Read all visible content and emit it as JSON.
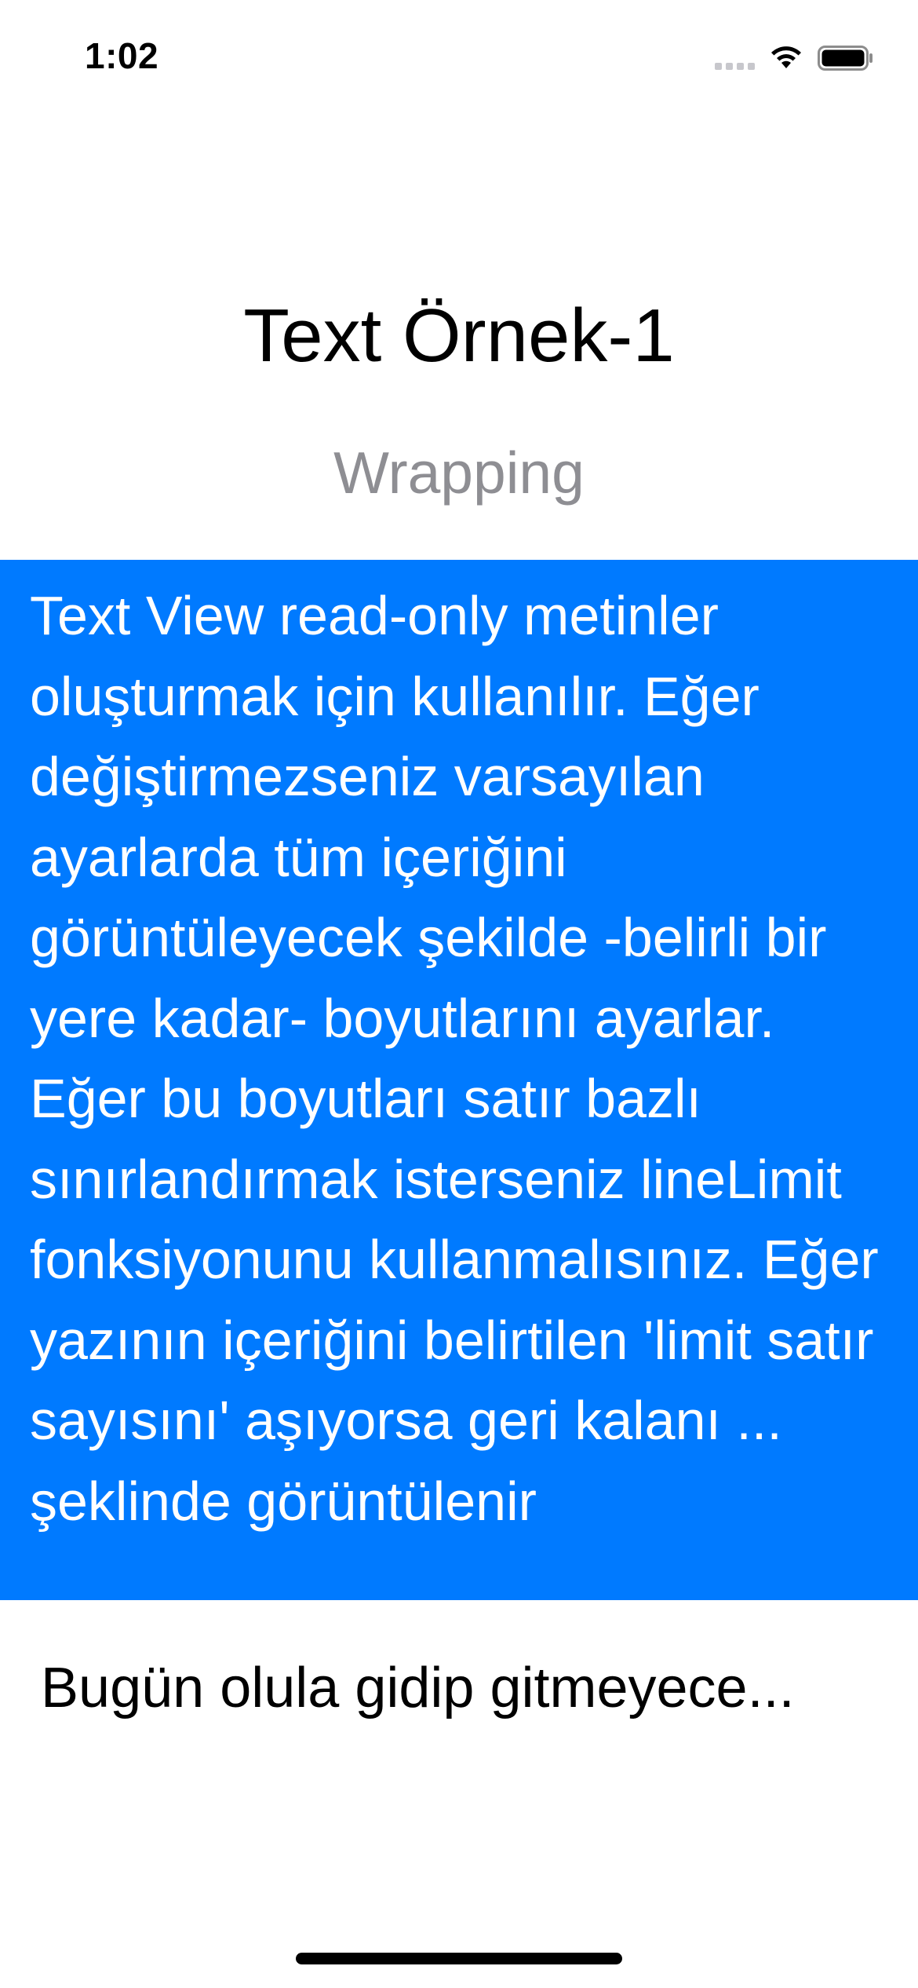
{
  "status_bar": {
    "time": "1:02",
    "icons": [
      "signal-icon",
      "wifi-icon",
      "battery-icon"
    ]
  },
  "screen": {
    "title": "Text Örnek-1",
    "subtitle": "Wrapping",
    "wrapped_text": "Text View read-only metinler oluşturmak için kullanılır. Eğer değiştirmezseniz varsayılan ayarlarda tüm içeriğini görüntüleyecek şekilde -belirli bir yere kadar- boyutlarını ayarlar. Eğer bu boyutları satır bazlı sınırlandırmak isterseniz lineLimit fonksiyonunu kullanmalısınız. Eğer yazının içeriğini belirtilen 'limit satır sayısını' aşıyorsa geri kalanı ... şeklinde görüntülenir",
    "truncated_text": "Bugün olula gidip gitmeyece..."
  },
  "colors": {
    "accent": "#007aff",
    "background": "#ffffff",
    "subtitle": "#8e8e93",
    "text": "#000000"
  }
}
